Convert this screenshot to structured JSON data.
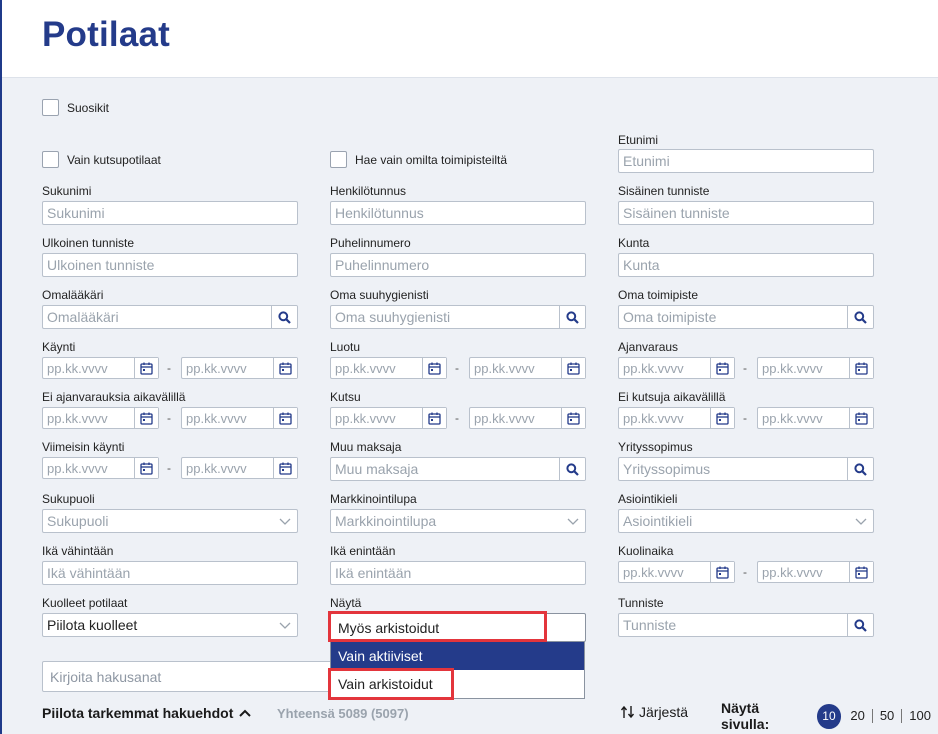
{
  "page": {
    "title": "Potilaat"
  },
  "checkboxes": {
    "favorites": "Suosikit",
    "only_invited": "Vain kutsupotilaat",
    "own_locations": "Hae vain omilta toimipisteiltä"
  },
  "fields": {
    "firstname": {
      "label": "Etunimi",
      "placeholder": "Etunimi"
    },
    "lastname": {
      "label": "Sukunimi",
      "placeholder": "Sukunimi"
    },
    "ssn": {
      "label": "Henkilötunnus",
      "placeholder": "Henkilötunnus"
    },
    "internal_id": {
      "label": "Sisäinen tunniste",
      "placeholder": "Sisäinen tunniste"
    },
    "external_id": {
      "label": "Ulkoinen tunniste",
      "placeholder": "Ulkoinen tunniste"
    },
    "phone": {
      "label": "Puhelinnumero",
      "placeholder": "Puhelinnumero"
    },
    "municipality": {
      "label": "Kunta",
      "placeholder": "Kunta"
    },
    "own_doctor": {
      "label": "Omalääkäri",
      "placeholder": "Omalääkäri"
    },
    "own_hygienist": {
      "label": "Oma suuhygienisti",
      "placeholder": "Oma suuhygienisti"
    },
    "own_location": {
      "label": "Oma toimipiste",
      "placeholder": "Oma toimipiste"
    },
    "visit": {
      "label": "Käynti"
    },
    "created": {
      "label": "Luotu"
    },
    "booking": {
      "label": "Ajanvaraus"
    },
    "no_bookings": {
      "label": "Ei ajanvarauksia aikavälillä"
    },
    "invite": {
      "label": "Kutsu"
    },
    "no_invites": {
      "label": "Ei kutsuja aikavälillä"
    },
    "last_visit": {
      "label": "Viimeisin käynti"
    },
    "other_payer": {
      "label": "Muu maksaja",
      "placeholder": "Muu maksaja"
    },
    "company_contract": {
      "label": "Yrityssopimus",
      "placeholder": "Yrityssopimus"
    },
    "gender": {
      "label": "Sukupuoli",
      "placeholder": "Sukupuoli"
    },
    "marketing": {
      "label": "Markkinointilupa",
      "placeholder": "Markkinointilupa"
    },
    "language": {
      "label": "Asiointikieli",
      "placeholder": "Asiointikieli"
    },
    "age_min": {
      "label": "Ikä vähintään",
      "placeholder": "Ikä vähintään"
    },
    "age_max": {
      "label": "Ikä enintään",
      "placeholder": "Ikä enintään"
    },
    "death_date": {
      "label": "Kuolinaika"
    },
    "deceased": {
      "label": "Kuolleet potilaat",
      "value": "Piilota kuolleet"
    },
    "show": {
      "label": "Näytä",
      "value": "Myös arkistoidut"
    },
    "identifier": {
      "label": "Tunniste",
      "placeholder": "Tunniste"
    }
  },
  "date_placeholder": "pp.kk.vvvv",
  "range_separator": "-",
  "show_dropdown": {
    "options": [
      "Vain aktiiviset",
      "Vain arkistoidut"
    ]
  },
  "search": {
    "placeholder": "Kirjoita hakusanat"
  },
  "footer": {
    "hide_filters": "Piilota tarkemmat hakuehdot",
    "total": "Yhteensä 5089 (5097)",
    "sort": "Järjestä",
    "per_page_label": "Näytä sivulla:",
    "per_page_options": [
      "10",
      "20",
      "50",
      "100"
    ]
  },
  "colors": {
    "brand": "#243b8a",
    "highlight": "#e3353c"
  }
}
